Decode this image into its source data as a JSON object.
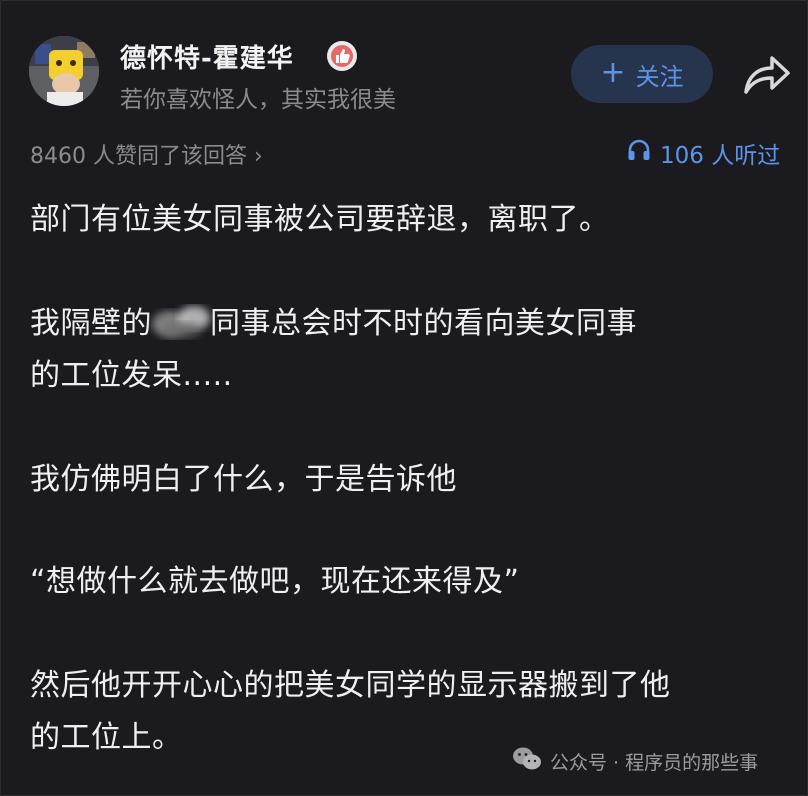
{
  "author": {
    "name": "德怀特-霍建华",
    "bio": "若你喜欢怪人，其实我很美"
  },
  "follow_button": {
    "label": "关注"
  },
  "likes_text": "8460 人赞同了该回答 ›",
  "listen_text": "106 人听过",
  "paragraphs": {
    "p1": "部门有位美女同事被公司要辞退，离职了。",
    "p2_before": "我隔壁的",
    "p2_after": "同事总会时不时的看向美女同事",
    "p2_line2": "的工位发呆.....",
    "p3": "我仿佛明白了什么，于是告诉他",
    "p4": "“想做什么就去做吧，现在还来得及”",
    "p5_line1": "然后他开开心心的把美女同学的显示器搬到了他",
    "p5_line2": "的工位上。"
  },
  "watermark": {
    "text": "公众号 · 程序员的那些事"
  },
  "colors": {
    "background": "#1b1b1f",
    "accent": "#5b95ea",
    "follow_bg": "#26344d",
    "muted": "#8a8a90"
  },
  "icons": [
    "thumbs-up-badge-icon",
    "share-arrow-icon",
    "headphones-icon",
    "wechat-icon",
    "avatar-image"
  ]
}
